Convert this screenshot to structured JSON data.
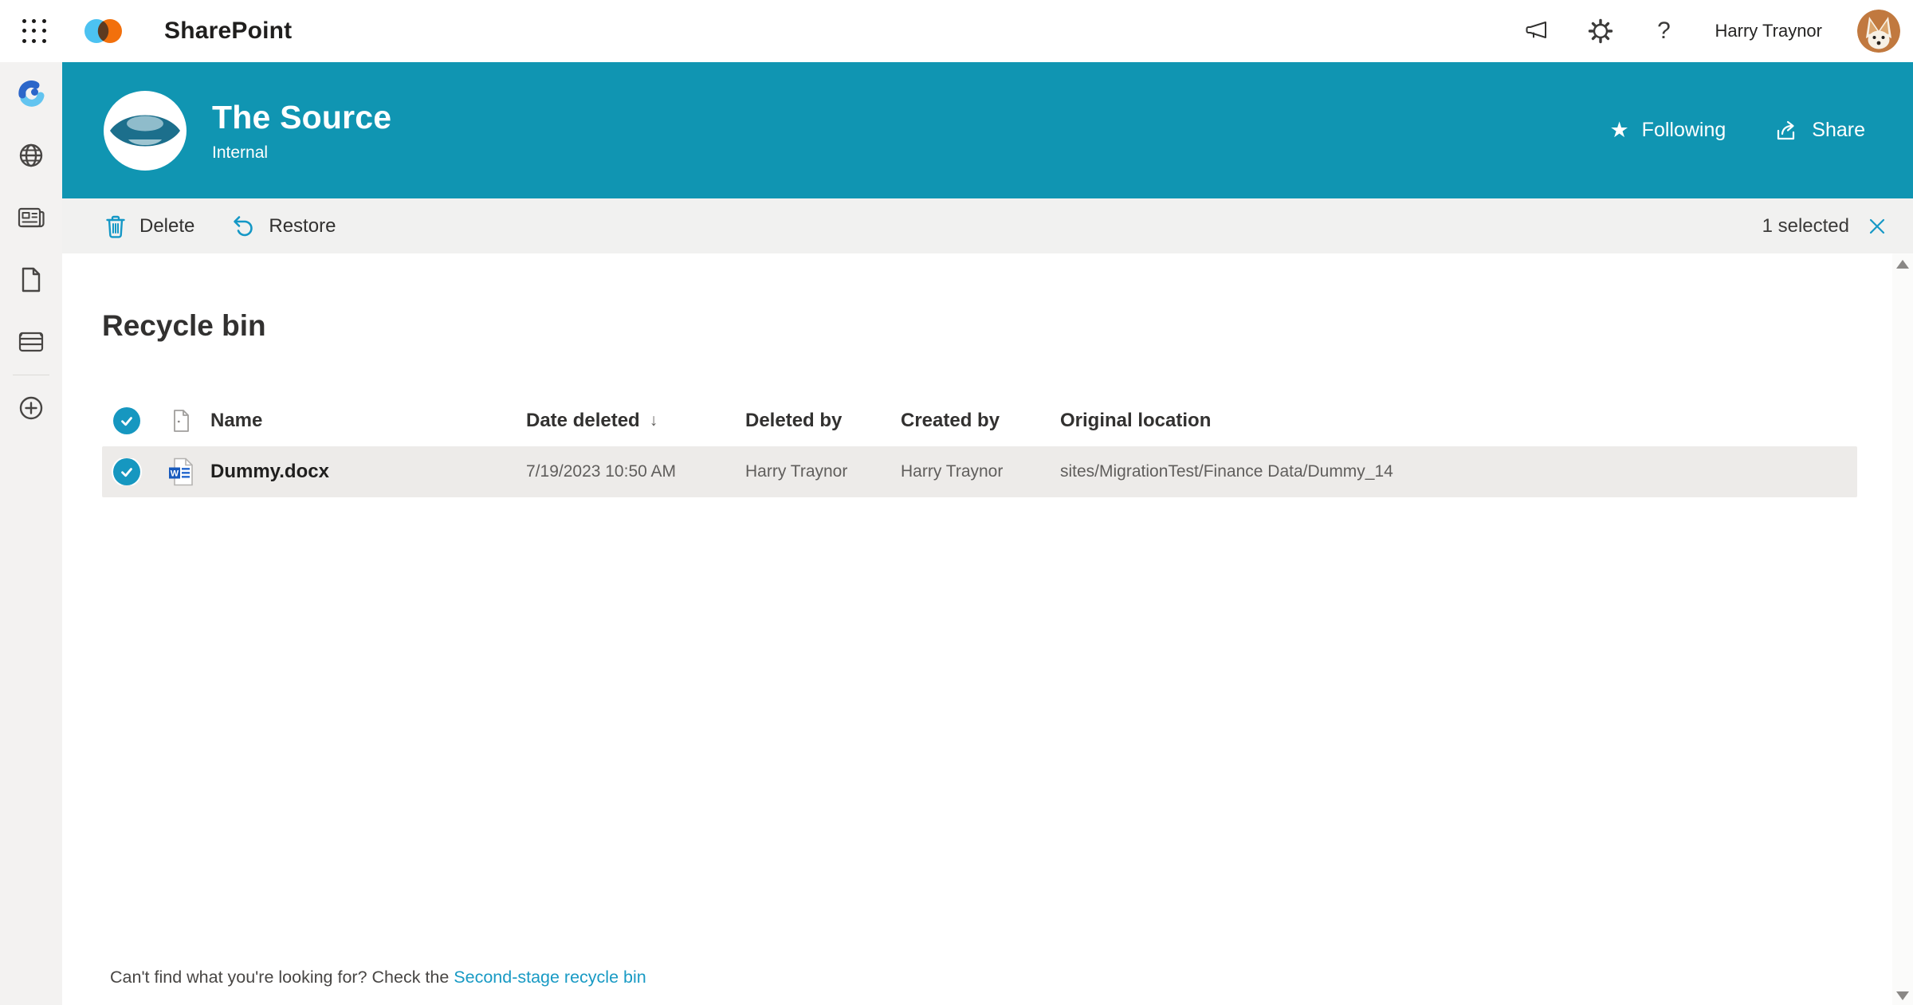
{
  "topbar": {
    "app_name": "SharePoint",
    "user_name": "Harry Traynor",
    "help_glyph": "?"
  },
  "site_header": {
    "title": "The Source",
    "subtitle": "Internal",
    "following_label": "Following",
    "star_glyph": "★",
    "share_label": "Share"
  },
  "toolbar": {
    "delete_label": "Delete",
    "restore_label": "Restore",
    "selection_status": "1 selected"
  },
  "main": {
    "heading": "Recycle bin",
    "table": {
      "columns": {
        "name": "Name",
        "date_deleted": "Date deleted",
        "deleted_by": "Deleted by",
        "created_by": "Created by",
        "original_location": "Original location"
      },
      "sort_column": "Date deleted",
      "sort_direction": "descending",
      "sort_glyph": "↓",
      "select_all_checked": true,
      "rows": [
        {
          "selected": true,
          "file_type": "word-document",
          "name": "Dummy.docx",
          "date_deleted": "7/19/2023 10:50 AM",
          "deleted_by": "Harry Traynor",
          "created_by": "Harry Traynor",
          "original_location": "sites/MigrationTest/Finance Data/Dummy_14"
        }
      ]
    },
    "footer": {
      "prefix": "Can't find what you're looking for? Check the ",
      "link_label": "Second-stage recycle bin"
    }
  },
  "icons": {
    "word_letter": "W"
  },
  "colors": {
    "header_teal": "#1095b2",
    "accent": "#1598c6",
    "selected_row": "#edebe9",
    "link": "#189ac4"
  }
}
